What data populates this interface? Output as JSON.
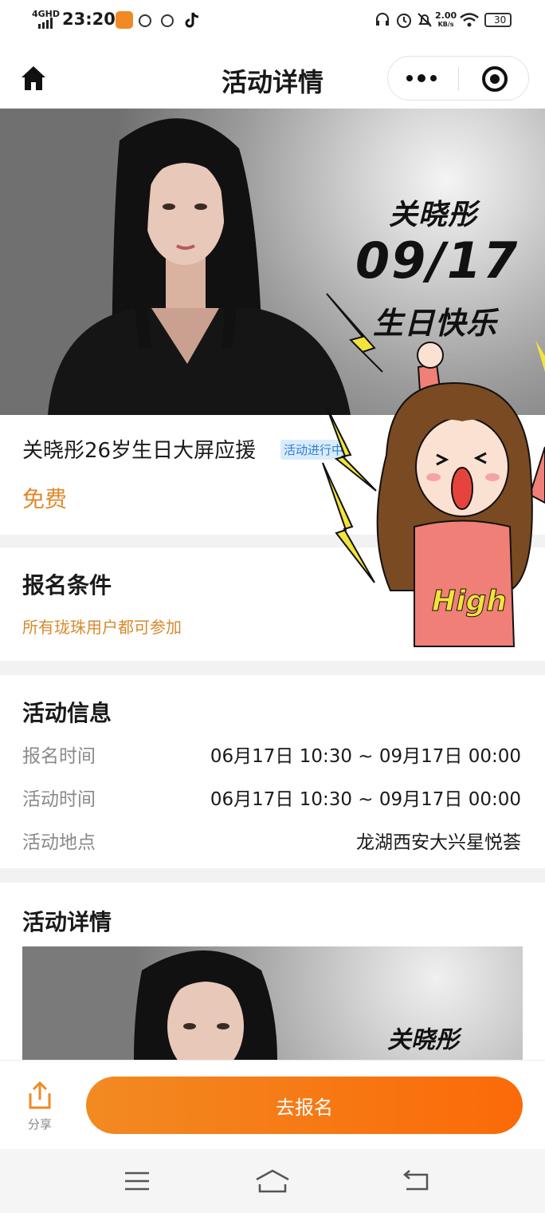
{
  "status_bar": {
    "network": "4GHD",
    "time": "23:20",
    "speed_value": "2.00",
    "speed_unit": "KB/s",
    "battery": "30"
  },
  "nav": {
    "title": "活动详情"
  },
  "hero": {
    "name": "关晓彤",
    "date": "09/17",
    "greeting": "生日快乐",
    "sticker_text": "High"
  },
  "event": {
    "title": "关晓彤26岁生日大屏应援",
    "status": "活动进行中",
    "price": "免费"
  },
  "conditions": {
    "title": "报名条件",
    "text": "所有珑珠用户都可参加"
  },
  "info": {
    "title": "活动信息",
    "rows": [
      {
        "label": "报名时间",
        "value": "06月17日 10:30 ~ 09月17日 00:00"
      },
      {
        "label": "活动时间",
        "value": "06月17日 10:30 ~ 09月17日 00:00"
      },
      {
        "label": "活动地点",
        "value": "龙湖西安大兴星悦荟"
      }
    ]
  },
  "details": {
    "title": "活动详情",
    "image_text": "关晓彤"
  },
  "bottom": {
    "share_label": "分享",
    "signup_label": "去报名"
  },
  "colors": {
    "accent": "#fb6a08",
    "price": "#e0892b",
    "badge_text": "#2f7fd6",
    "badge_bg": "#d9ecfb"
  }
}
